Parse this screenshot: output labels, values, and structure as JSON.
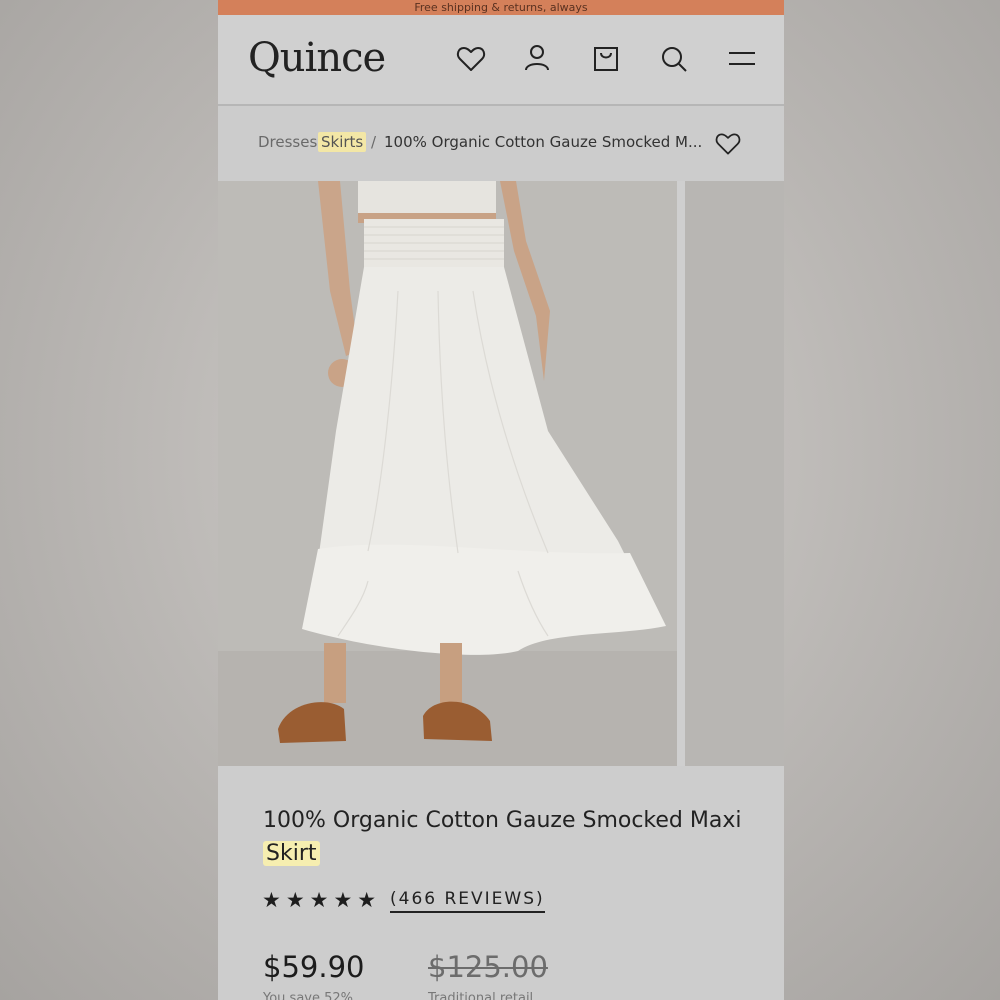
{
  "promo": {
    "text": "Free shipping & returns, always"
  },
  "header": {
    "logo": "Quince",
    "icons": [
      "heart-icon",
      "user-icon",
      "bag-icon",
      "search-icon",
      "menu-icon"
    ]
  },
  "breadcrumb": {
    "items": [
      "Dresses",
      "Skirts",
      "/",
      "100% Organic Cotton Gauze Smocked M..."
    ]
  },
  "product": {
    "title_main": "100% Organic Cotton Gauze Smocked Maxi",
    "title_highlight": "Skirt",
    "stars": "★★★★★",
    "reviews": "(466 REVIEWS)",
    "price": "$59.90",
    "old_price": "$125.00",
    "savings_label": "You save 52%",
    "retail_label": "Traditional retail"
  },
  "colors": {
    "promo": "#d4805a",
    "highlight": "#f3e7a6"
  }
}
